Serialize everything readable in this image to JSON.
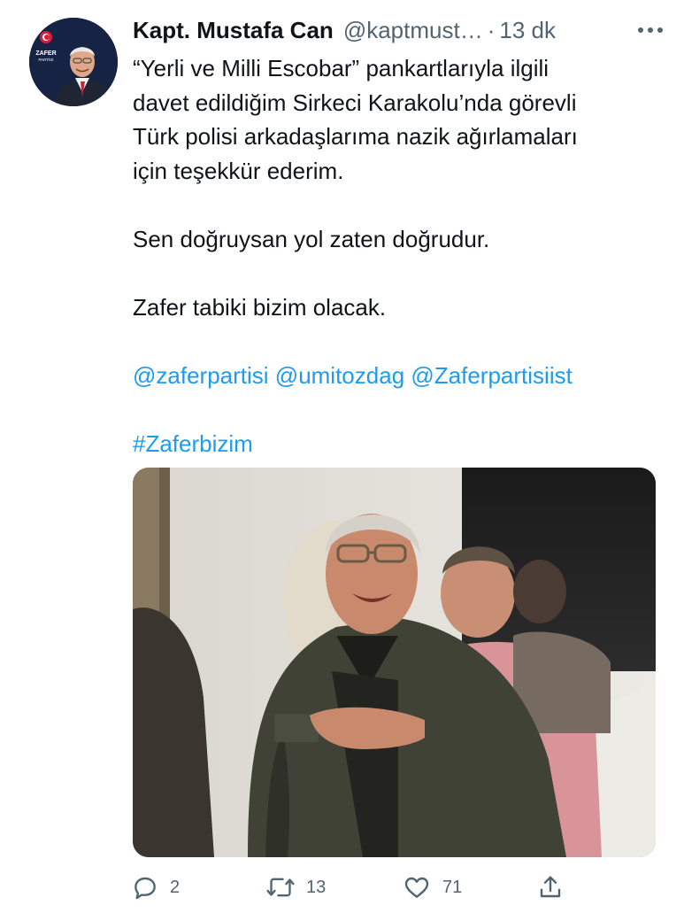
{
  "author": {
    "display_name": "Kapt. Mustafa Can",
    "handle": "@kaptmust…",
    "separator": "·",
    "time": "13 dk",
    "avatar_logo_text": "ZAFER",
    "avatar_logo_subtext": "PARTİSİ"
  },
  "tweet": {
    "lines": [
      "“Yerli ve Milli Escobar” pankartlarıyla ilgili",
      "davet edildiğim Sirkeci Karakolu’nda görevli",
      "Türk polisi arkadaşlarıma nazik ağırlamaları",
      "için teşekkür ederim."
    ],
    "line2": "Sen doğruysan yol zaten doğrudur.",
    "line3": "Zafer tabiki bizim olacak.",
    "mentions": [
      "@zaferpartisi",
      "@umitozdag",
      "@Zaferpartisiist"
    ],
    "hashtag": "#Zaferbizim"
  },
  "actions": {
    "reply_count": "2",
    "retweet_count": "13",
    "like_count": "71"
  },
  "icons": {
    "more": "more-dots-icon",
    "reply": "reply-bubble-icon",
    "retweet": "retweet-icon",
    "like": "heart-icon",
    "share": "share-icon"
  },
  "colors": {
    "link": "#1d9bf0",
    "secondary_text": "#536471",
    "primary_text": "#0f1419"
  }
}
